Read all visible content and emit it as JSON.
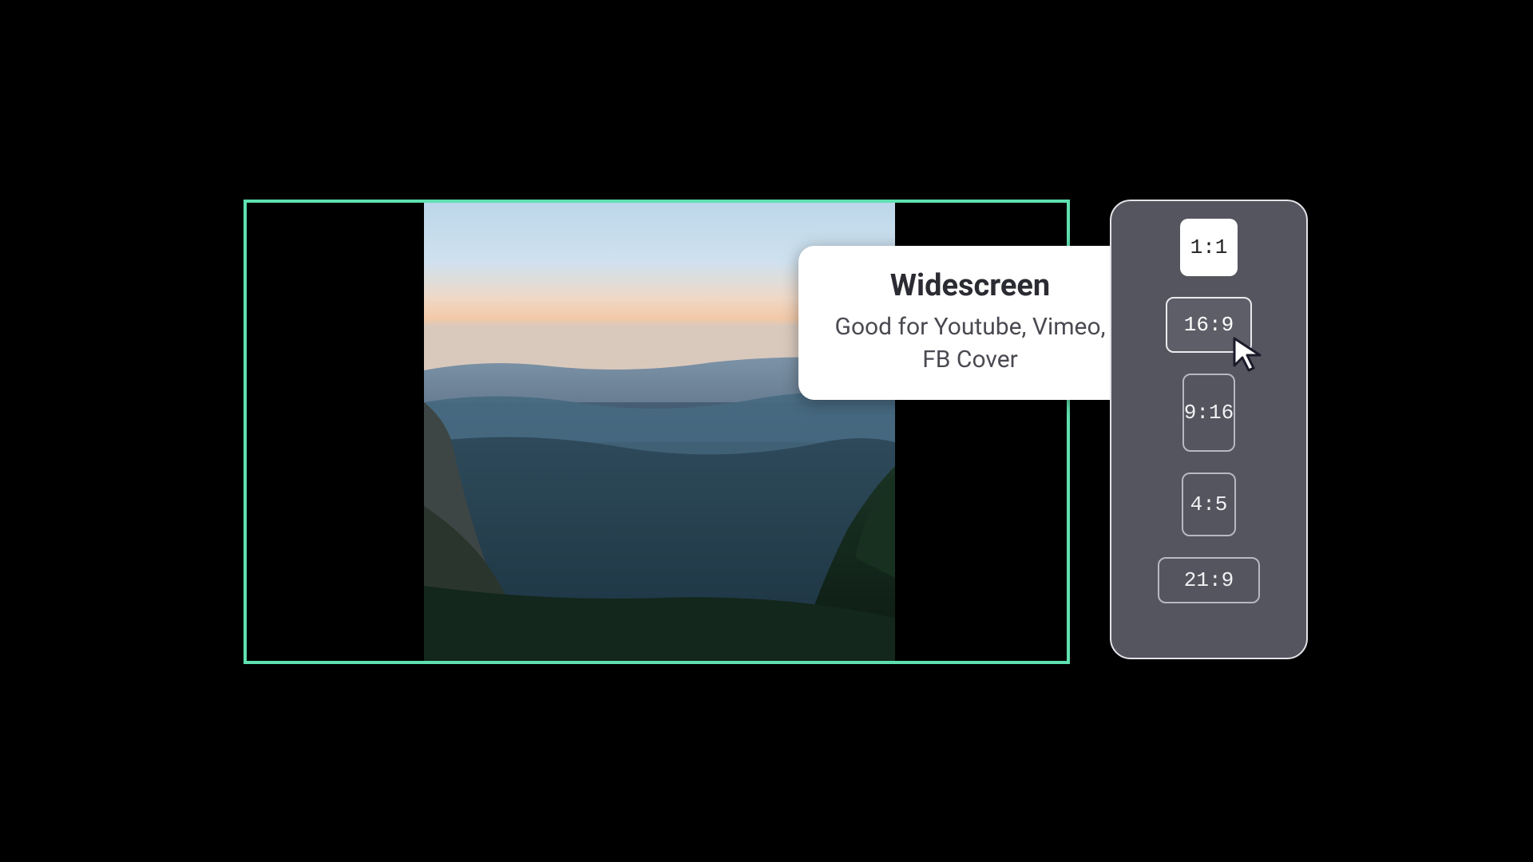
{
  "tooltip": {
    "title": "Widescreen",
    "description": "Good for Youtube, Vimeo, FB Cover"
  },
  "ratio_panel": {
    "options": [
      {
        "label": "1:1",
        "state": "current"
      },
      {
        "label": "16:9",
        "state": "selected"
      },
      {
        "label": "9:16",
        "state": ""
      },
      {
        "label": "4:5",
        "state": ""
      },
      {
        "label": "21:9",
        "state": ""
      }
    ]
  },
  "colors": {
    "accent": "#5fe0b0",
    "panel": "#54555e"
  }
}
